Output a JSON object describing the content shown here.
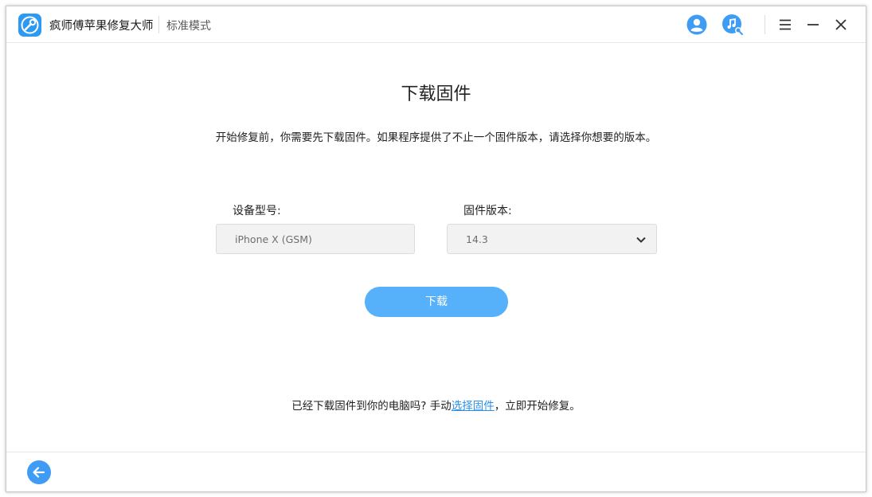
{
  "app": {
    "name": "疯师傅苹果修复大师",
    "mode": "标准模式"
  },
  "titlebar": {
    "icons": [
      "account-icon",
      "music-search-icon",
      "menu-icon",
      "minimize-icon",
      "close-icon"
    ]
  },
  "page": {
    "title": "下载固件",
    "description": "开始修复前，你需要先下载固件。如果程序提供了不止一个固件版本，请选择你想要的版本。"
  },
  "form": {
    "device_label": "设备型号:",
    "device_value": "iPhone X (GSM)",
    "firmware_label": "固件版本:",
    "firmware_value": "14.3"
  },
  "actions": {
    "download_label": "下载"
  },
  "hint": {
    "prefix": "已经下载固件到你的电脑吗? 手动",
    "link": "选择固件",
    "suffix": "，立即开始修复。"
  },
  "colors": {
    "accent": "#56b1fa",
    "link": "#2b8fe8",
    "logo": "#2c9af2"
  }
}
